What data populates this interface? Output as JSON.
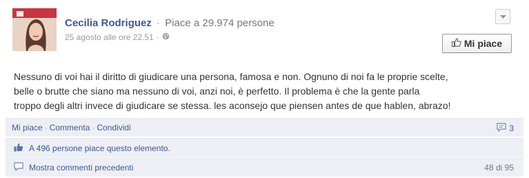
{
  "post": {
    "author": "Cecilia Rodriguez",
    "separator": "·",
    "likes_text": "Piace a 29.974 persone",
    "timestamp": "25 agosto alle ore 22.51",
    "timestamp_dot": "·",
    "like_page_button": "Mi piace",
    "message": "Nessuno di voi hai il diritto di giudicare una persona, famosa e non. Ognuno di noi fa le proprie scelte,\nbelle o brutte che siano ma nessuno di voi, anzi noi, è perfetto. Il problema è che la gente parla\ntroppo degli altri invece di giudicare se stessa. les aconsejo que piensen antes de que hablen, abrazo!"
  },
  "actions": {
    "like": "Mi piace",
    "comment": "Commenta",
    "share": "Condividi",
    "sep1": "·",
    "sep2": "·",
    "comment_count": "3"
  },
  "likes_row": {
    "text": "A 496 persone piace questo elemento."
  },
  "comments_row": {
    "show_previous": "Mostra commenti precedenti",
    "pager": "48 di 95"
  },
  "colors": {
    "link": "#3b5998",
    "panel": "#edeff4",
    "muted": "#999999"
  },
  "icons": {
    "avatar": "profile-photo",
    "globe": "globe-icon",
    "chevron": "chevron-down-icon",
    "thumb": "thumbs-up-icon",
    "comment": "comment-icon"
  }
}
